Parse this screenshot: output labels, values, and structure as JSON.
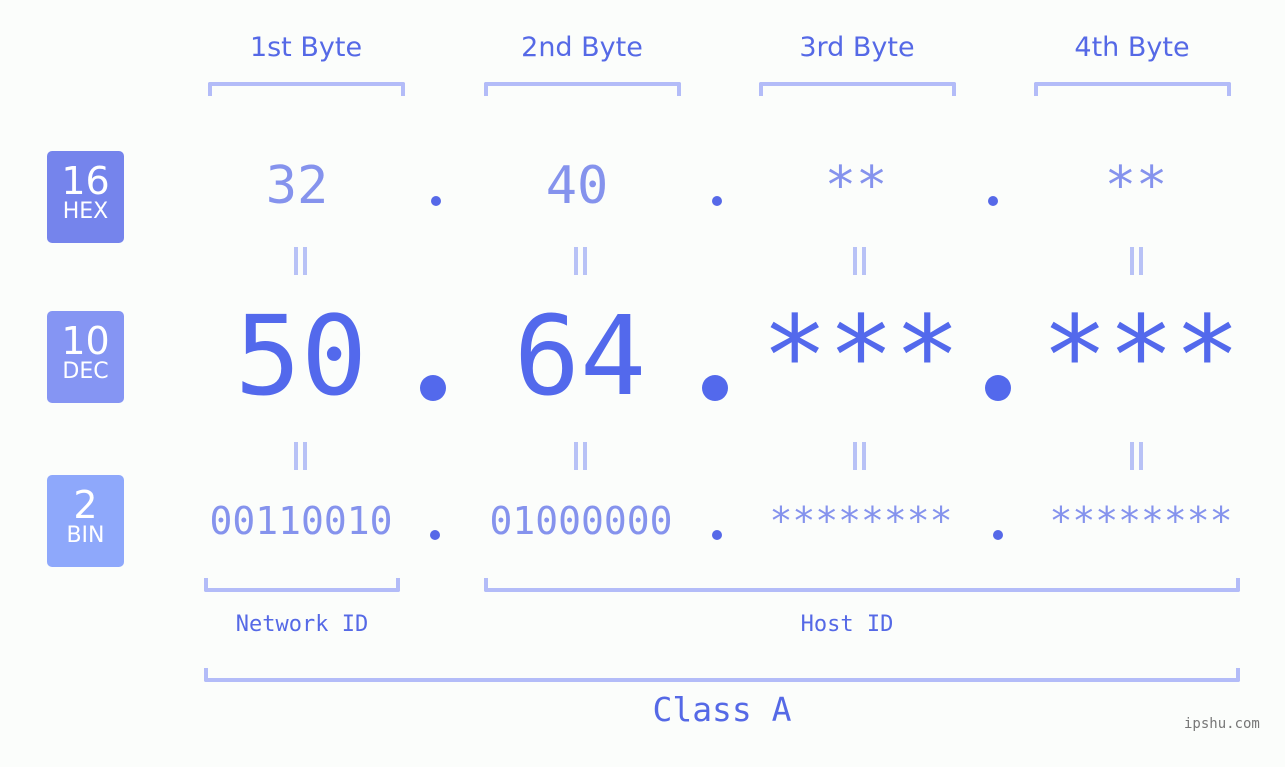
{
  "bytes": {
    "headers": [
      "1st Byte",
      "2nd Byte",
      "3rd Byte",
      "4th Byte"
    ]
  },
  "rows": {
    "hex": {
      "base": "16",
      "name": "HEX",
      "values": [
        "32",
        "40",
        "**",
        "**"
      ]
    },
    "dec": {
      "base": "10",
      "name": "DEC",
      "values": [
        "50",
        "64",
        "***",
        "***"
      ]
    },
    "bin": {
      "base": "2",
      "name": "BIN",
      "values": [
        "00110010",
        "01000000",
        "********",
        "********"
      ]
    }
  },
  "segments": {
    "network_id": "Network ID",
    "host_id": "Host ID",
    "class": "Class A"
  },
  "watermark": "ipshu.com",
  "colors": {
    "accent": "#5369ec",
    "light_value": "#8593ed",
    "bracket": "#b3bcf8",
    "hex_badge": "#7584ec",
    "dec_badge": "#8595f3",
    "bin_badge": "#8ea8fb"
  }
}
